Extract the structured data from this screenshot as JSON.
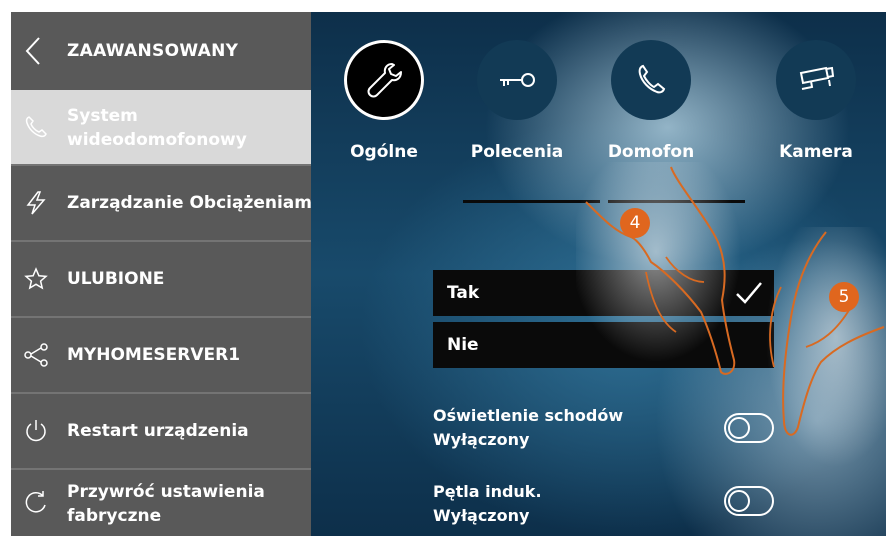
{
  "sidebar": {
    "title": "ZAAWANSOWANY",
    "items": [
      {
        "label": "System wideodomofonowy",
        "line1": "System",
        "line2": "wideodomofonowy"
      },
      {
        "label": "Zarządzanie Obciążeniami"
      },
      {
        "label": "ULUBIONE"
      },
      {
        "label": "MYHOMESERVER1"
      },
      {
        "label": "Restart urządzenia"
      },
      {
        "label": "Przywróć ustawienia fabryczne",
        "line1": "Przywróć ustawienia",
        "line2": "fabryczne"
      }
    ]
  },
  "tabs": [
    {
      "label": "Ogólne",
      "icon": "wrench-icon"
    },
    {
      "label": "Polecenia",
      "icon": "key-icon"
    },
    {
      "label": "Domofon",
      "icon": "phone-icon"
    },
    {
      "label": "Kamera",
      "icon": "camera-icon"
    }
  ],
  "options": [
    {
      "label": "Tak",
      "selected": true
    },
    {
      "label": "Nie",
      "selected": false
    }
  ],
  "settings": [
    {
      "name": "Oświetlenie schodów",
      "value": "Wyłączony",
      "on": false
    },
    {
      "name": "Pętla induk.",
      "value": "Wyłączony",
      "on": false
    }
  ],
  "badges": [
    "4",
    "5"
  ],
  "colors": {
    "sidebar": "#595959",
    "active_item": "#d9d9d9",
    "badge": "#e0661e",
    "panel": "#0a0a0a"
  }
}
